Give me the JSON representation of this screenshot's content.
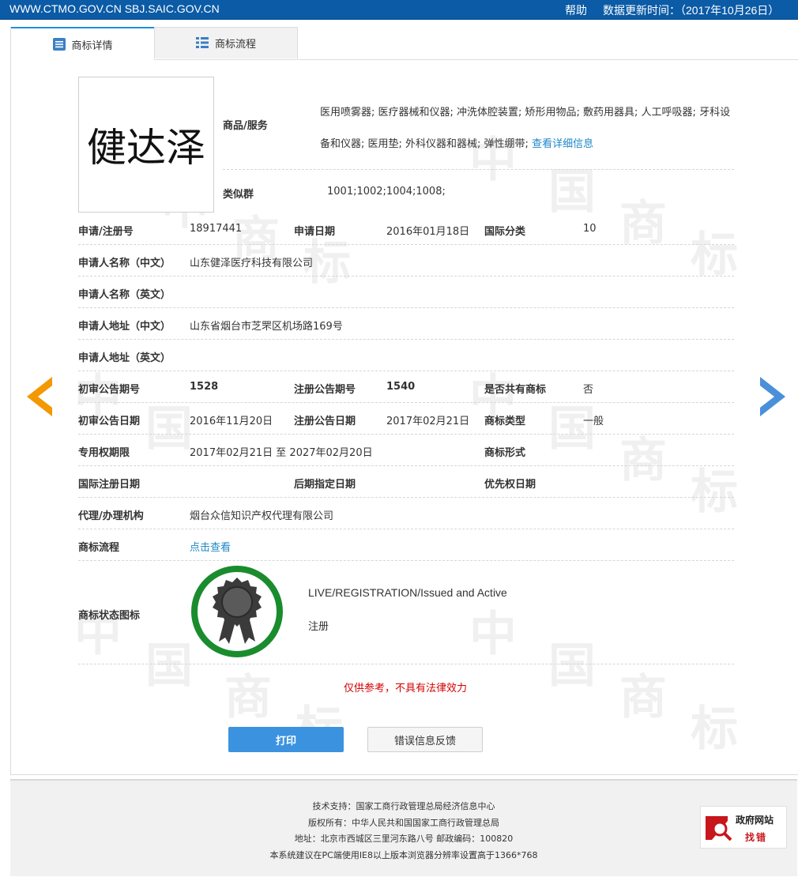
{
  "topbar": {
    "site": "WWW.CTMO.GOV.CN SBJ.SAIC.GOV.CN",
    "help": "帮助",
    "update": "数据更新时间：（2017年10月26日）"
  },
  "tabs": [
    {
      "label": "商标详情",
      "icon": "list-detail-icon"
    },
    {
      "label": "商标流程",
      "icon": "list-icon"
    }
  ],
  "watermark": {
    "chars": [
      "中",
      "国",
      "商",
      "标"
    ]
  },
  "trademark": {
    "image_text": "健达泽",
    "goods_label": "商品/服务",
    "goods_text": "医用喷雾器; 医疗器械和仪器; 冲洗体腔装置; 矫形用物品; 敷药用器具; 人工呼吸器; 牙科设备和仪器; 医用垫; 外科仪器和器械; 弹性绷带;",
    "goods_link": "查看详细信息",
    "similar_label": "类似群",
    "similar_value": "1001;1002;1004;1008;"
  },
  "details": {
    "reg_no_label": "申请/注册号",
    "reg_no": "18917441",
    "app_date_label": "申请日期",
    "app_date": "2016年01月18日",
    "intl_class_label": "国际分类",
    "intl_class": "10",
    "applicant_cn_label": "申请人名称（中文）",
    "applicant_cn": "山东健泽医疗科技有限公司",
    "applicant_en_label": "申请人名称（英文）",
    "applicant_en": "",
    "address_cn_label": "申请人地址（中文）",
    "address_cn": "山东省烟台市芝罘区机场路169号",
    "address_en_label": "申请人地址（英文）",
    "address_en": "",
    "prelim_no_label": "初审公告期号",
    "prelim_no": "1528",
    "reg_pub_no_label": "注册公告期号",
    "reg_pub_no": "1540",
    "shared_label": "是否共有商标",
    "shared": "否",
    "prelim_date_label": "初审公告日期",
    "prelim_date": "2016年11月20日",
    "reg_pub_date_label": "注册公告日期",
    "reg_pub_date": "2017年02月21日",
    "type_label": "商标类型",
    "type": "一般",
    "term_label": "专用权期限",
    "term": "2017年02月21日 至 2027年02月20日",
    "form_label": "商标形式",
    "form": "",
    "intl_reg_date_label": "国际注册日期",
    "intl_reg_date": "",
    "later_date_label": "后期指定日期",
    "later_date": "",
    "priority_date_label": "优先权日期",
    "priority_date": "",
    "agent_label": "代理/办理机构",
    "agent": "烟台众信知识产权代理有限公司",
    "flow_label": "商标流程",
    "flow_link": "点击查看",
    "status_label": "商标状态图标",
    "status_en": "LIVE/REGISTRATION/Issued and Active",
    "status_cn": "注册"
  },
  "disclaimer": "仅供参考，不具有法律效力",
  "buttons": {
    "print": "打印",
    "feedback": "错误信息反馈"
  },
  "footer": {
    "line1": "技术支持：国家工商行政管理总局经济信息中心",
    "line2": "版权所有：中华人民共和国国家工商行政管理总局",
    "line3": "地址：北京市西城区三里河东路八号  邮政编码：100820",
    "line4": "本系统建议在PC端使用IE8以上版本浏览器分辨率设置高于1366*768",
    "gov_badge_1": "政府网站",
    "gov_badge_2": "找错"
  },
  "colors": {
    "accent": "#1e87c8",
    "topbar": "#0b5ba6",
    "badge_green": "#1a8c2e",
    "prev_arrow": "#f39800",
    "next_arrow": "#4a90d9",
    "disclaimer": "#d40000"
  }
}
